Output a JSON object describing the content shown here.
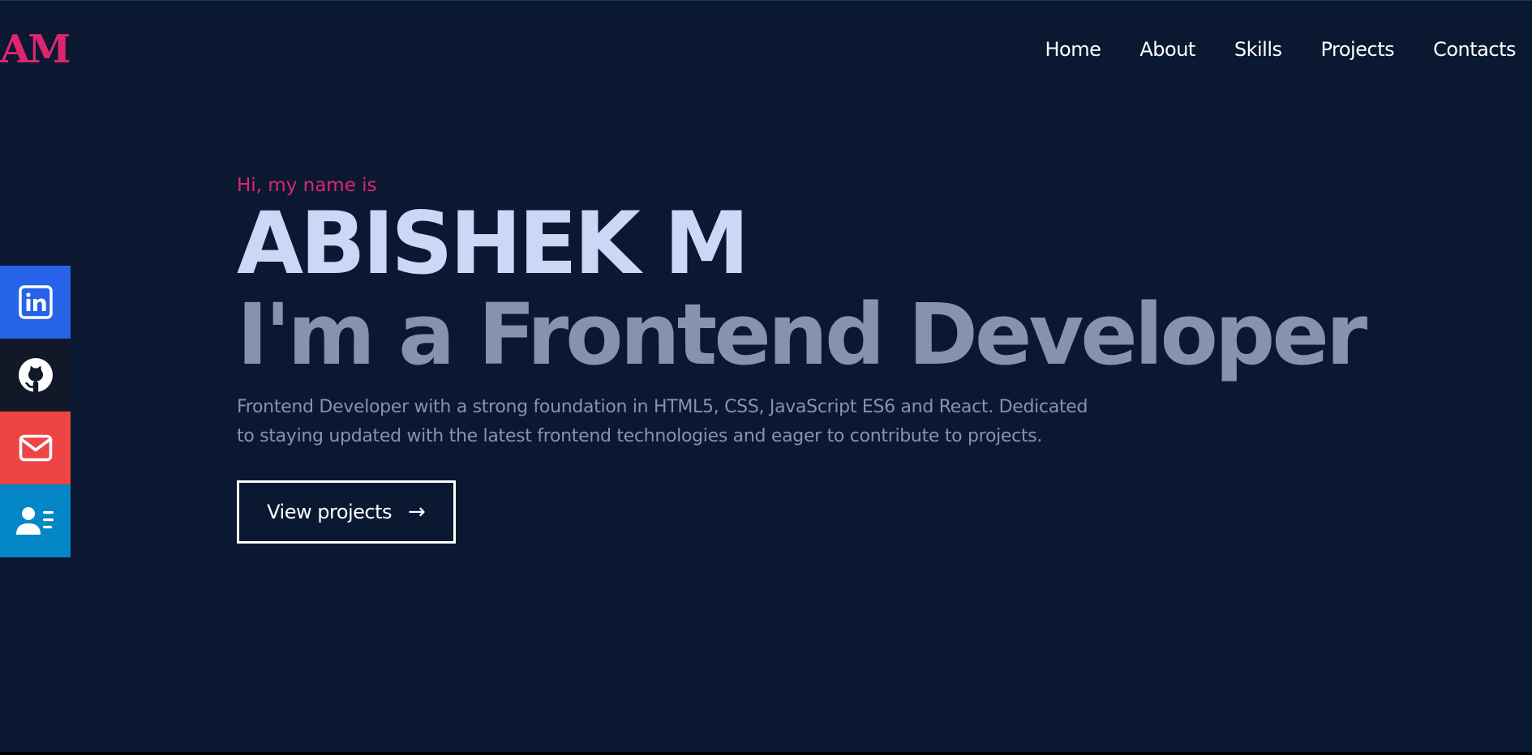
{
  "logo": "AM",
  "nav": [
    "Home",
    "About",
    "Skills",
    "Projects",
    "Contacts"
  ],
  "social": [
    {
      "icon": "linkedin-icon",
      "color": "#2763e9"
    },
    {
      "icon": "github-icon",
      "color": "#111827"
    },
    {
      "icon": "mail-icon",
      "color": "#ef4444"
    },
    {
      "icon": "resume-icon",
      "color": "#0586c7"
    }
  ],
  "hero": {
    "greeting": "Hi, my name is",
    "name": "ABISHEK M",
    "role": "I'm a Frontend Developer",
    "description": "Frontend Developer with a strong foundation in HTML5, CSS, JavaScript ES6 and React. Dedicated to staying updated with the latest frontend technologies and eager to contribute to projects.",
    "button_label": "View projects",
    "button_arrow": "→"
  },
  "colors": {
    "background": "#0a1931",
    "accent": "#e0256f",
    "name": "#ccd6f6",
    "muted": "#8892b0"
  }
}
